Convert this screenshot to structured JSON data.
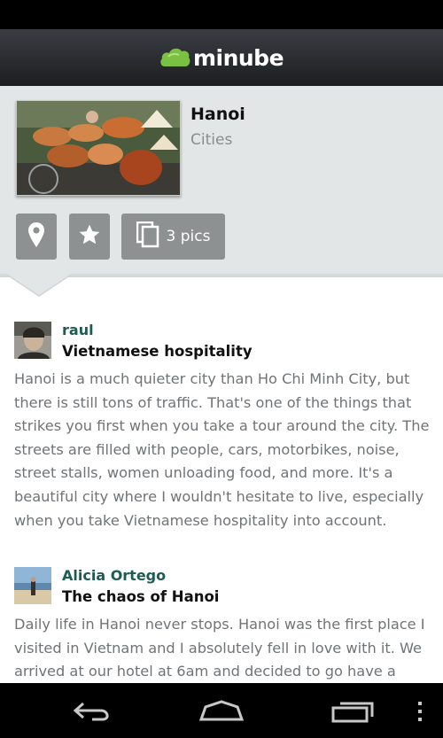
{
  "app": {
    "logo_text": "minube"
  },
  "place": {
    "name": "Hanoi",
    "category": "Cities",
    "actions": {
      "pics_label": "3 pics"
    }
  },
  "reviews": [
    {
      "user": "raul",
      "title": "Vietnamese hospitality",
      "body": "Hanoi is a much quieter city than Ho Chi Minh City, but there is still tons of traffic. That's one of the things that strikes you first when you take a tour around the city. The streets are filled with people, cars, motorbikes, noise, street stalls, women unloading food, and more. It's a beautiful city where I wouldn't hesitate to live, especially when you take Vietnamese hospitality into account."
    },
    {
      "user": "Alicia Ortego",
      "title": "The chaos of Hanoi",
      "body": "Daily life in Hanoi never stops. Hanoi was the first place I visited in Vietnam and I absolutely fell in love with it. We arrived at our hotel at 6am and decided to go have a walk"
    }
  ],
  "colors": {
    "username": "#1e5c53",
    "action_button": "#8e9192",
    "header_bg": "#e3e6e7",
    "logo_green": "#7ac043"
  },
  "icons": [
    "minube-logo-icon",
    "map-pin-icon",
    "star-icon",
    "photos-icon",
    "back-icon",
    "home-icon",
    "recent-apps-icon",
    "overflow-menu-icon"
  ]
}
